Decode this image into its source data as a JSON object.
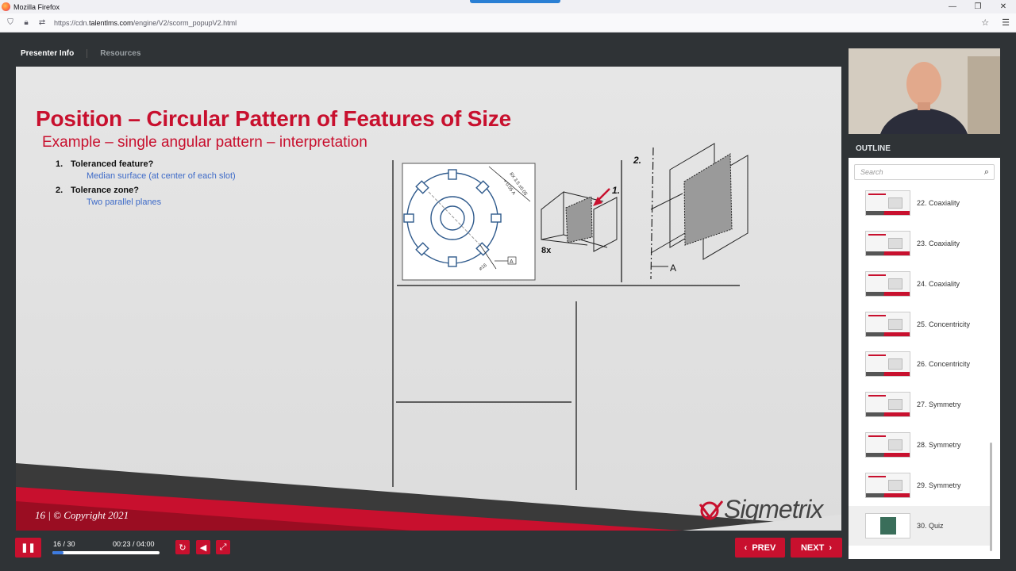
{
  "browser": {
    "window_title": "Mozilla Firefox",
    "url_prefix": "https://cdn.",
    "url_domain": "talentlms.com",
    "url_path": "/engine/V2/scorm_popupV2.html"
  },
  "player_tabs": {
    "presenter": "Presenter Info",
    "resources": "Resources"
  },
  "slide": {
    "title": "Position – Circular Pattern of Features of Size",
    "subtitle": "Example – single angular pattern – interpretation",
    "items": [
      {
        "num": "1.",
        "question": "Toleranced feature?",
        "answer": "Median surface (at center of each slot)"
      },
      {
        "num": "2.",
        "question": "Tolerance zone?",
        "answer": "Two parallel planes"
      }
    ],
    "drawing_labels": {
      "label_8x": "8x",
      "label_1": "1.",
      "label_2": "2.",
      "label_A": "A",
      "dim_slot": "8X 3.5 ±0.05",
      "dim_pos": "⌖ 0.05 A",
      "dim_dia": "⌀16",
      "datum": "A"
    },
    "footer": "16 | © Copyright 2021",
    "logo_text": "Sigmetrix",
    "colors": {
      "accent": "#c8102e",
      "answer": "#3e6bc8"
    }
  },
  "controls": {
    "slide_count": "16 / 30",
    "time": "00:23 / 04:00",
    "progress_fraction": 0.1,
    "prev_label": "PREV",
    "next_label": "NEXT"
  },
  "outline": {
    "header": "OUTLINE",
    "search_placeholder": "Search",
    "items": [
      {
        "label": "22. Coaxiality"
      },
      {
        "label": "23. Coaxiality"
      },
      {
        "label": "24. Coaxiality"
      },
      {
        "label": "25. Concentricity"
      },
      {
        "label": "26. Concentricity"
      },
      {
        "label": "27. Symmetry"
      },
      {
        "label": "28. Symmetry"
      },
      {
        "label": "29. Symmetry"
      },
      {
        "label": "30. Quiz"
      }
    ]
  }
}
